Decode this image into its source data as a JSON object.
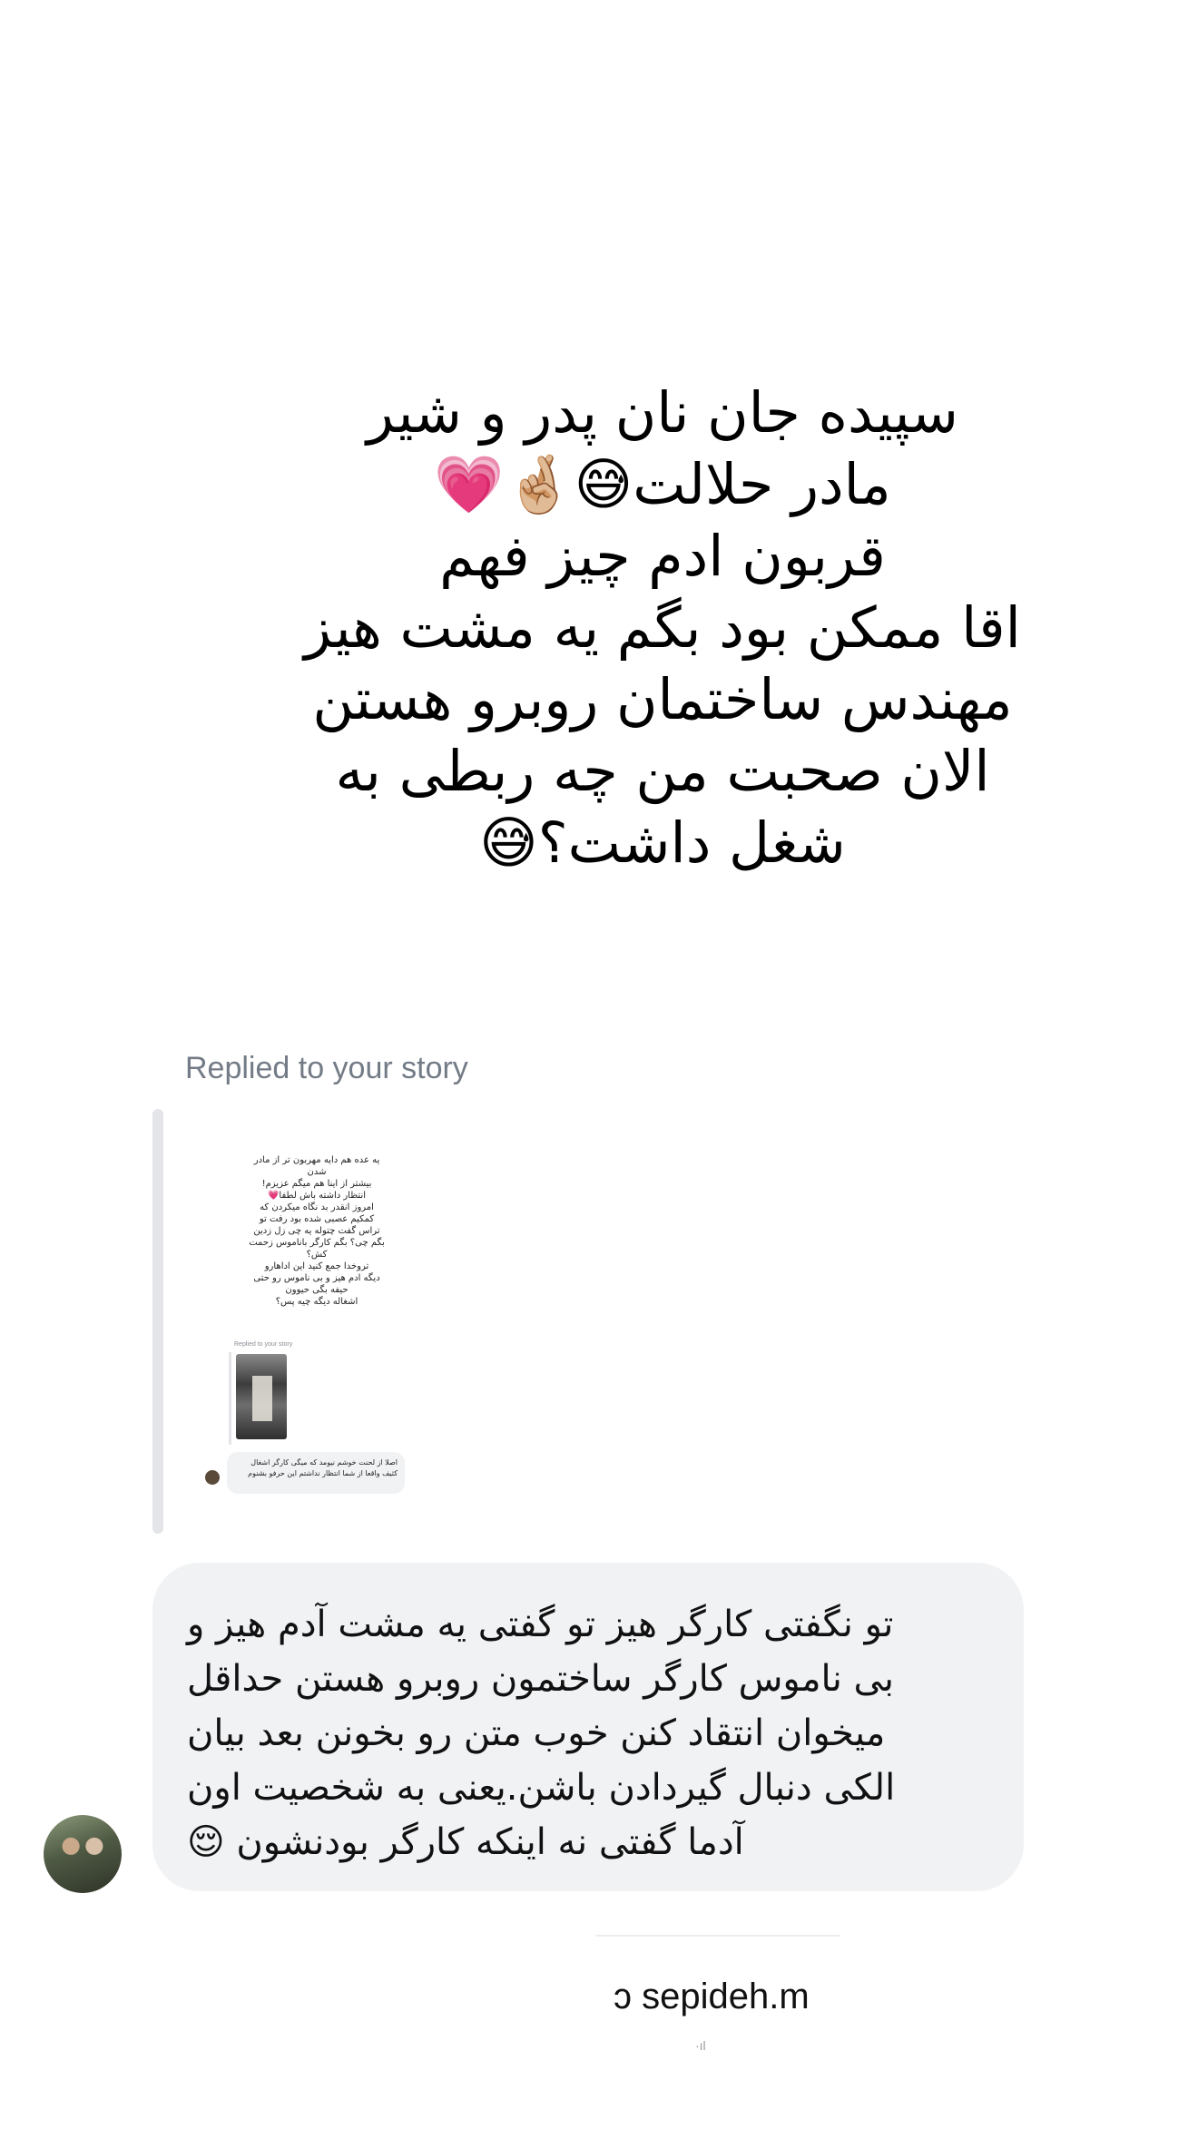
{
  "story": {
    "lines": [
      "سپیده جان نان پدر و شیر",
      "مادر حلالت😅🤞🏼💗",
      "قربون ادم چیز فهم",
      "اقا ممکن بود بگم یه مشت هیز",
      "مهندس ساختمان روبرو هستن",
      "الان صحبت من چه ربطی به",
      "شغل داشت؟😅"
    ]
  },
  "reply": {
    "label": "Replied to your story",
    "thumbnail": {
      "text": "یه عده هم دایه مهربون تر از مادر شدن\nبیشتر از اینا هم میگم عزیزم!\nانتظار داشته باش لطفا💗\nامروز انقدر بد نگاه میکردن که کمکیم عصبی شده بود رفت تو تراس گفت چتوله یه چی زل زدین\nبگم چی؟ بگم کارگر باناموس زحمت کش؟\nتروخدا جمع کنید این اداهارو\nدیگه ادم هیز و بی ناموس رو حتی حیفه بگی حیوون\nاشغاله دیگه چیه پس؟",
      "replied_label": "Replied to your story",
      "bubble_text": "اصلا از لحنت خوشم نیومد که میگی کارگر اشغال کثیف واقعا از شما انتظار نداشتم این حرفو بشنوم"
    }
  },
  "message": {
    "lines": [
      "تو نگفتی کارگر هیز تو گفتی یه مشت آدم هیز و",
      "بی ناموس کارگر ساختمون روبرو هستن حداقل",
      "میخوان انتقاد کنن خوب متن رو بخونن بعد بیان",
      "الکی دنبال گیردادن باشن.یعنی به شخصیت اون",
      "آدما گفتی نه اینکه کارگر بودنشون 😌"
    ]
  },
  "footer": {
    "username": "ɔ sepideh.m",
    "dots": "·ıl"
  }
}
